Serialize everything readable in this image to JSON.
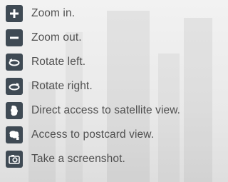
{
  "items": [
    {
      "label": "Zoom in.",
      "icon": "zoom-in-icon"
    },
    {
      "label": "Zoom out.",
      "icon": "zoom-out-icon"
    },
    {
      "label": "Rotate left.",
      "icon": "rotate-left-icon"
    },
    {
      "label": "Rotate right.",
      "icon": "rotate-right-icon"
    },
    {
      "label": "Direct access to satellite view.",
      "icon": "satellite-view-icon"
    },
    {
      "label": "Access to postcard view.",
      "icon": "postcard-view-icon"
    },
    {
      "label": "Take a screenshot.",
      "icon": "camera-icon"
    }
  ],
  "colors": {
    "icon_background": "#3f4a54",
    "text": "#505050"
  }
}
